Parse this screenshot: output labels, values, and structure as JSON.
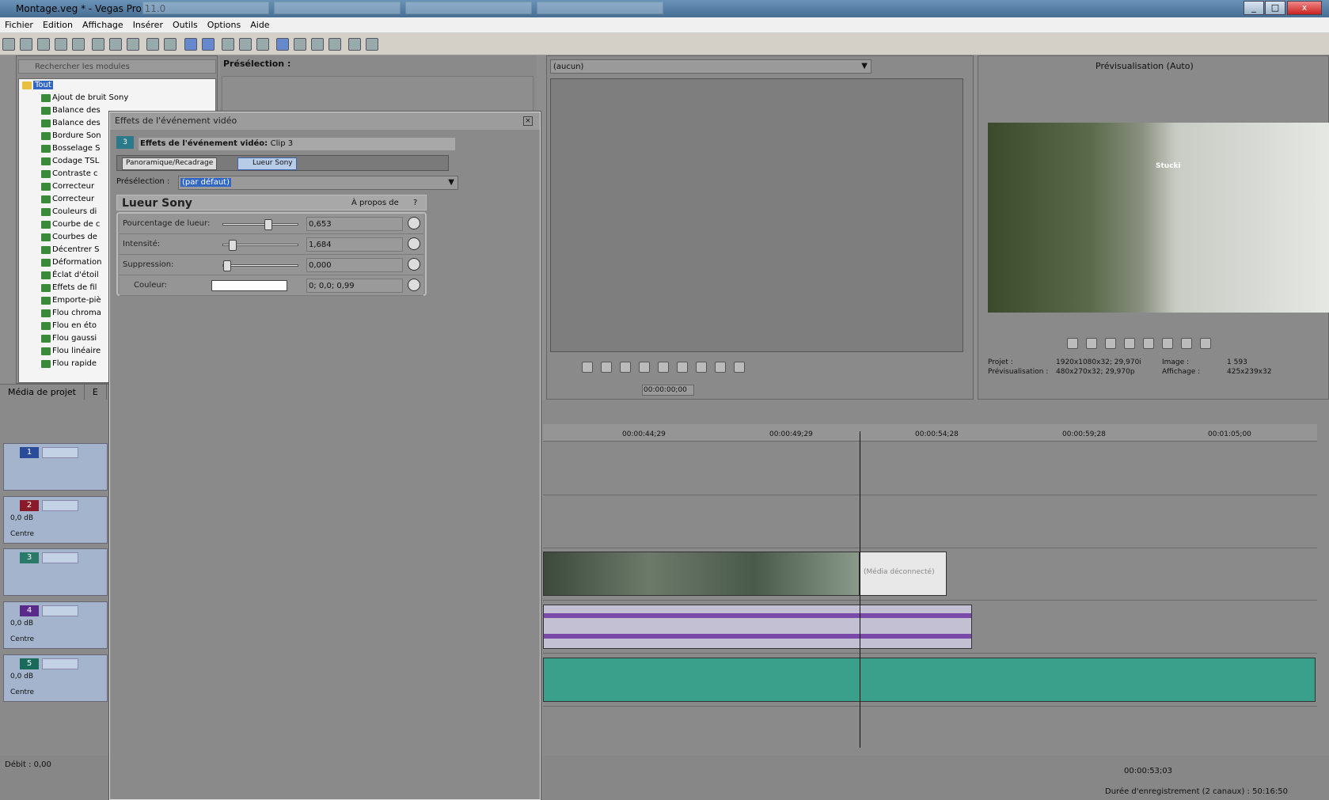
{
  "window": {
    "title": "Montage.veg * - Vegas Pro 11.0"
  },
  "menu": [
    "Fichier",
    "Edition",
    "Affichage",
    "Insérer",
    "Outils",
    "Options",
    "Aide"
  ],
  "explorer": {
    "search_placeholder": "Rechercher les modules",
    "root": "Tout",
    "items": [
      "Ajout de bruit Sony",
      "Balance des",
      "Balance des",
      "Bordure Son",
      "Bosselage S",
      "Codage TSL",
      "Contraste c",
      "Correcteur",
      "Correcteur",
      "Couleurs di",
      "Courbe de c",
      "Courbes de",
      "Décentrer S",
      "Déformation",
      "Éclat d'étoil",
      "Effets de fil",
      "Emporte-piè",
      "Flou chroma",
      "Flou en éto",
      "Flou gaussi",
      "Flou linéaire",
      "Flou rapide"
    ]
  },
  "preselection_panel": {
    "label": "Présélection :"
  },
  "bottom_tabs": [
    "Média de projet",
    "E"
  ],
  "trimmer": {
    "select": "(aucun)",
    "timecode": "00:00:00;00"
  },
  "preview": {
    "mode": "Prévisualisation (Auto)",
    "projet_label": "Projet :",
    "projet_val": "1920x1080x32; 29,970i",
    "prev_label": "Prévisualisation :",
    "prev_val": "480x270x32; 29,970p",
    "image_label": "Image :",
    "image_val": "1 593",
    "aff_label": "Affichage :",
    "aff_val": "425x239x32",
    "overlay_text": "Stucki"
  },
  "dialog": {
    "title": "Effets de l'événement vidéo",
    "chain_title": "Effets de l'événement vidéo:",
    "clip": "Clip 3",
    "track_badge": "3",
    "chain": [
      "Panoramique/Recadrage",
      "Lueur Sony"
    ],
    "preset_label": "Présélection :",
    "preset_value": "(par défaut)",
    "fx_name": "Lueur Sony",
    "about": "À propos de",
    "help": "?",
    "params": [
      {
        "label": "Pourcentage de lueur:",
        "value": "0,653",
        "level": 0.6
      },
      {
        "label": "Intensité:",
        "value": "1,684",
        "level": 0.08
      },
      {
        "label": "Suppression:",
        "value": "0,000",
        "level": 0.0
      },
      {
        "label": "Couleur:",
        "value": "0; 0,0; 0,99",
        "level": null
      }
    ]
  },
  "timeline": {
    "ticks": [
      "00:00:44;29",
      "00:00:49;29",
      "00:00:54;28",
      "00:00:59;28",
      "00:01:05;00"
    ],
    "tracks": [
      {
        "num": "1",
        "type": "video",
        "color": "#2a4a9a"
      },
      {
        "num": "2",
        "type": "audio",
        "color": "#8a1a2a",
        "vol": "0,0 dB",
        "pan": "Centre"
      },
      {
        "num": "3",
        "type": "video",
        "color": "#2a7a6a"
      },
      {
        "num": "4",
        "type": "audio",
        "color": "#5a2a8a",
        "vol": "0,0 dB",
        "pan": "Centre"
      },
      {
        "num": "5",
        "type": "audio",
        "color": "#1a6a5a",
        "vol": "0,0 dB",
        "pan": "Centre"
      }
    ],
    "media_offline": "(Média déconnecté)"
  },
  "status": {
    "rate": "Débit : 0,00",
    "cursor_time": "00:00:53;03",
    "record": "Durée d'enregistrement (2 canaux) : 50:16:50"
  }
}
